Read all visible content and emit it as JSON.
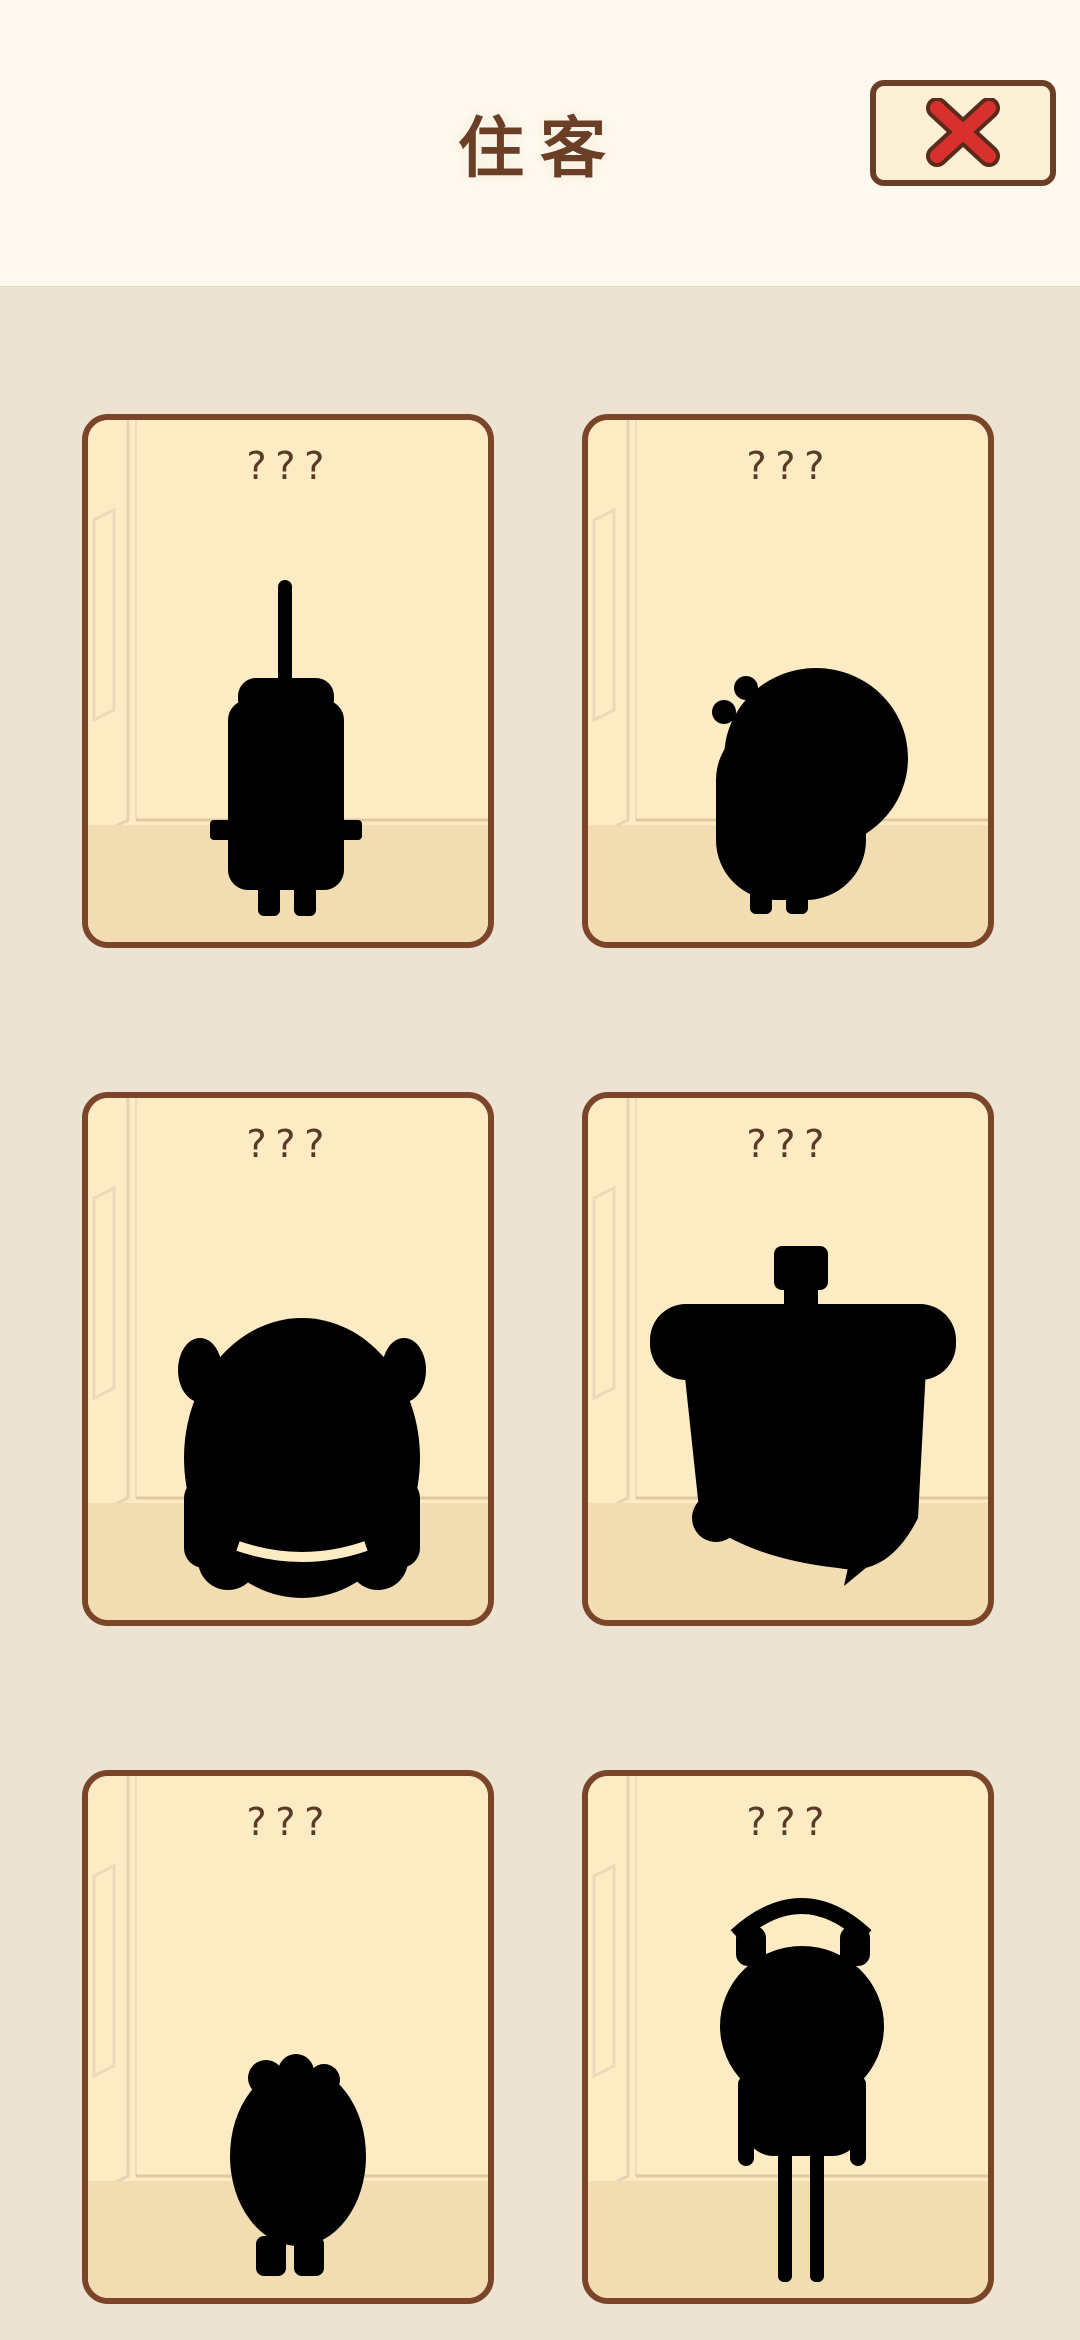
{
  "header": {
    "title": "住客"
  },
  "close_button": {
    "icon": "close-icon",
    "color": "#d8312d"
  },
  "colors": {
    "card_border": "#7a4528",
    "card_bg": "#fff2d4",
    "page_bg": "#ede3d3"
  },
  "cards": [
    {
      "name": "???",
      "silhouette": "tall-rocket-creature"
    },
    {
      "name": "???",
      "silhouette": "round-antenna-creature"
    },
    {
      "name": "???",
      "silhouette": "big-round-eared-creature"
    },
    {
      "name": "???",
      "silhouette": "flat-hat-creature"
    },
    {
      "name": "???",
      "silhouette": "small-fuzzy-creature"
    },
    {
      "name": "???",
      "silhouette": "headphone-frog-creature"
    }
  ]
}
